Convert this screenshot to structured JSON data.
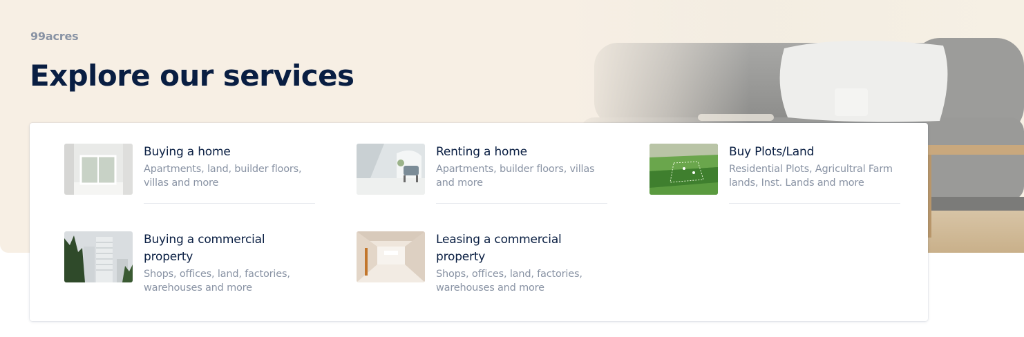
{
  "brand": "99acres",
  "page_title": "Explore our services",
  "services": [
    {
      "title": "Buying a home",
      "description": "Apartments, land, builder floors, villas and more",
      "icon": "white-interior-photo"
    },
    {
      "title": "Renting a home",
      "description": "Apartments, builder floors, villas and more",
      "icon": "living-room-photo"
    },
    {
      "title": "Buy Plots/Land",
      "description": "Residential Plots, Agricultral Farm lands, Inst. Lands and more",
      "icon": "green-land-aerial-photo"
    },
    {
      "title": "Buying a commercial property",
      "description": "Shops, offices, land, factories, warehouses and more",
      "icon": "highrise-building-photo"
    },
    {
      "title": "Leasing a commercial property",
      "description": "Shops, offices, land, factories, warehouses and more",
      "icon": "commercial-interior-photo"
    }
  ],
  "colors": {
    "hero_background": "#f7efe4",
    "title": "#091e42",
    "muted_text": "#8993a4",
    "divider": "#e6e9ee"
  }
}
